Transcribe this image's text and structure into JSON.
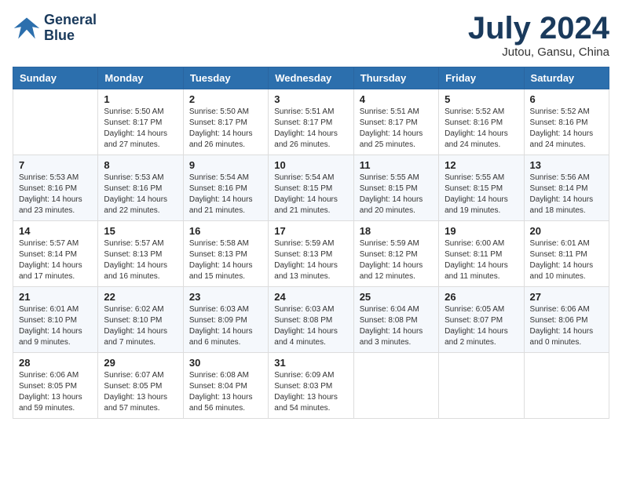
{
  "logo": {
    "line1": "General",
    "line2": "Blue"
  },
  "title": "July 2024",
  "location": "Jutou, Gansu, China",
  "days_header": [
    "Sunday",
    "Monday",
    "Tuesday",
    "Wednesday",
    "Thursday",
    "Friday",
    "Saturday"
  ],
  "weeks": [
    [
      {
        "day": "",
        "info": ""
      },
      {
        "day": "1",
        "info": "Sunrise: 5:50 AM\nSunset: 8:17 PM\nDaylight: 14 hours\nand 27 minutes."
      },
      {
        "day": "2",
        "info": "Sunrise: 5:50 AM\nSunset: 8:17 PM\nDaylight: 14 hours\nand 26 minutes."
      },
      {
        "day": "3",
        "info": "Sunrise: 5:51 AM\nSunset: 8:17 PM\nDaylight: 14 hours\nand 26 minutes."
      },
      {
        "day": "4",
        "info": "Sunrise: 5:51 AM\nSunset: 8:17 PM\nDaylight: 14 hours\nand 25 minutes."
      },
      {
        "day": "5",
        "info": "Sunrise: 5:52 AM\nSunset: 8:16 PM\nDaylight: 14 hours\nand 24 minutes."
      },
      {
        "day": "6",
        "info": "Sunrise: 5:52 AM\nSunset: 8:16 PM\nDaylight: 14 hours\nand 24 minutes."
      }
    ],
    [
      {
        "day": "7",
        "info": "Sunrise: 5:53 AM\nSunset: 8:16 PM\nDaylight: 14 hours\nand 23 minutes."
      },
      {
        "day": "8",
        "info": "Sunrise: 5:53 AM\nSunset: 8:16 PM\nDaylight: 14 hours\nand 22 minutes."
      },
      {
        "day": "9",
        "info": "Sunrise: 5:54 AM\nSunset: 8:16 PM\nDaylight: 14 hours\nand 21 minutes."
      },
      {
        "day": "10",
        "info": "Sunrise: 5:54 AM\nSunset: 8:15 PM\nDaylight: 14 hours\nand 21 minutes."
      },
      {
        "day": "11",
        "info": "Sunrise: 5:55 AM\nSunset: 8:15 PM\nDaylight: 14 hours\nand 20 minutes."
      },
      {
        "day": "12",
        "info": "Sunrise: 5:55 AM\nSunset: 8:15 PM\nDaylight: 14 hours\nand 19 minutes."
      },
      {
        "day": "13",
        "info": "Sunrise: 5:56 AM\nSunset: 8:14 PM\nDaylight: 14 hours\nand 18 minutes."
      }
    ],
    [
      {
        "day": "14",
        "info": "Sunrise: 5:57 AM\nSunset: 8:14 PM\nDaylight: 14 hours\nand 17 minutes."
      },
      {
        "day": "15",
        "info": "Sunrise: 5:57 AM\nSunset: 8:13 PM\nDaylight: 14 hours\nand 16 minutes."
      },
      {
        "day": "16",
        "info": "Sunrise: 5:58 AM\nSunset: 8:13 PM\nDaylight: 14 hours\nand 15 minutes."
      },
      {
        "day": "17",
        "info": "Sunrise: 5:59 AM\nSunset: 8:13 PM\nDaylight: 14 hours\nand 13 minutes."
      },
      {
        "day": "18",
        "info": "Sunrise: 5:59 AM\nSunset: 8:12 PM\nDaylight: 14 hours\nand 12 minutes."
      },
      {
        "day": "19",
        "info": "Sunrise: 6:00 AM\nSunset: 8:11 PM\nDaylight: 14 hours\nand 11 minutes."
      },
      {
        "day": "20",
        "info": "Sunrise: 6:01 AM\nSunset: 8:11 PM\nDaylight: 14 hours\nand 10 minutes."
      }
    ],
    [
      {
        "day": "21",
        "info": "Sunrise: 6:01 AM\nSunset: 8:10 PM\nDaylight: 14 hours\nand 9 minutes."
      },
      {
        "day": "22",
        "info": "Sunrise: 6:02 AM\nSunset: 8:10 PM\nDaylight: 14 hours\nand 7 minutes."
      },
      {
        "day": "23",
        "info": "Sunrise: 6:03 AM\nSunset: 8:09 PM\nDaylight: 14 hours\nand 6 minutes."
      },
      {
        "day": "24",
        "info": "Sunrise: 6:03 AM\nSunset: 8:08 PM\nDaylight: 14 hours\nand 4 minutes."
      },
      {
        "day": "25",
        "info": "Sunrise: 6:04 AM\nSunset: 8:08 PM\nDaylight: 14 hours\nand 3 minutes."
      },
      {
        "day": "26",
        "info": "Sunrise: 6:05 AM\nSunset: 8:07 PM\nDaylight: 14 hours\nand 2 minutes."
      },
      {
        "day": "27",
        "info": "Sunrise: 6:06 AM\nSunset: 8:06 PM\nDaylight: 14 hours\nand 0 minutes."
      }
    ],
    [
      {
        "day": "28",
        "info": "Sunrise: 6:06 AM\nSunset: 8:05 PM\nDaylight: 13 hours\nand 59 minutes."
      },
      {
        "day": "29",
        "info": "Sunrise: 6:07 AM\nSunset: 8:05 PM\nDaylight: 13 hours\nand 57 minutes."
      },
      {
        "day": "30",
        "info": "Sunrise: 6:08 AM\nSunset: 8:04 PM\nDaylight: 13 hours\nand 56 minutes."
      },
      {
        "day": "31",
        "info": "Sunrise: 6:09 AM\nSunset: 8:03 PM\nDaylight: 13 hours\nand 54 minutes."
      },
      {
        "day": "",
        "info": ""
      },
      {
        "day": "",
        "info": ""
      },
      {
        "day": "",
        "info": ""
      }
    ]
  ]
}
